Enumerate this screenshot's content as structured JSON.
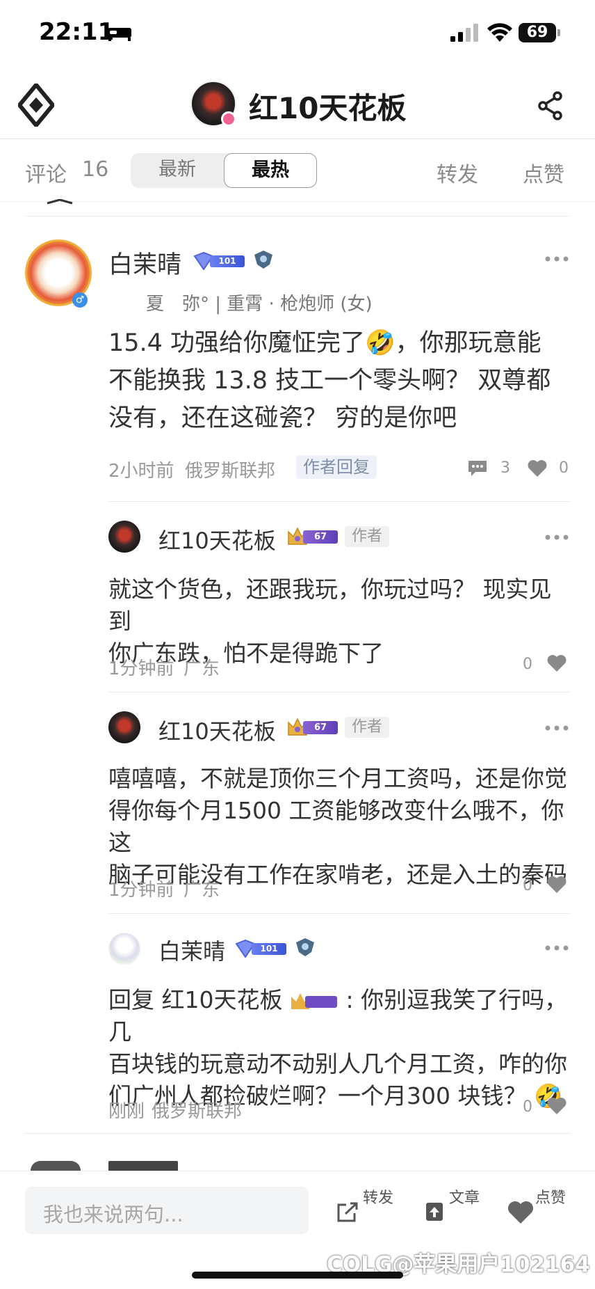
{
  "status_bar": {
    "time": "22:11",
    "battery": "69"
  },
  "header": {
    "title": "红10天花板"
  },
  "tabs": {
    "comments_label": "评论",
    "comments_count": "16",
    "sort_options": [
      "最新",
      "最热"
    ],
    "forward_label": "转发",
    "like_label": "点赞"
  },
  "main_comment": {
    "username": "白茉晴",
    "rank_level": "101",
    "sub_info": "夏　弥° | 重霄 · 枪炮师 (女)",
    "text_lines": [
      "15.4 功强给你魔怔完了🤣，你那玩意能",
      "不能换我 13.8 技工一个零头啊？ 双尊都",
      "没有，还在这碰瓷？ 穷的是你吧"
    ],
    "time": "2小时前",
    "location": "俄罗斯联邦",
    "author_reply_tag": "作者回复",
    "reply_count": "3",
    "like_count": "0"
  },
  "replies": [
    {
      "username": "红10天花板",
      "level": "67",
      "tag": "作者",
      "text_lines": [
        "就这个货色，还跟我玩，你玩过吗？ 现实见到",
        "你广东跌，怕不是得跪下了"
      ],
      "time": "1分钟前",
      "location": "广东",
      "like_count": "0"
    },
    {
      "username": "红10天花板",
      "level": "67",
      "tag": "作者",
      "text_lines": [
        "嘻嘻嘻，不就是顶你三个月工资吗，还是你觉",
        "得你每个月1500 工资能够改变什么哦不，你这",
        "脑子可能没有工作在家啃老，还是入土的秦码"
      ],
      "time": "1分钟前",
      "location": "广东",
      "like_count": "0"
    },
    {
      "username": "白茉晴",
      "level": "101",
      "reply_prefix": "回复",
      "reply_to": "红10天花板",
      "reply_to_level": "67",
      "text_first_rest": ": 你别逗我笑了行吗，几",
      "text_lines": [
        "百块钱的玩意动不动别人几个月工资，咋的你",
        "们广州人都捡破烂啊？一个月300 块钱？ 🤣"
      ],
      "time": "刚刚",
      "location": "俄罗斯联邦",
      "like_count": "0"
    }
  ],
  "bottom_bar": {
    "input_placeholder": "我也来说两句...",
    "forward_label": "转发",
    "article_label": "文章",
    "like_label": "点赞",
    "watermark": "COLG@苹果用户102164"
  },
  "colors": {
    "accent_text": "#333333",
    "muted": "#999999",
    "tag_bg": "#eef1f8",
    "rank_bar": "#3b55d6",
    "level_bar": "#5f3fb8"
  },
  "icons": [
    "app-logo-icon",
    "share-icon",
    "more-icon",
    "comment-bubble-icon",
    "heart-icon",
    "forward-icon",
    "article-icon"
  ]
}
